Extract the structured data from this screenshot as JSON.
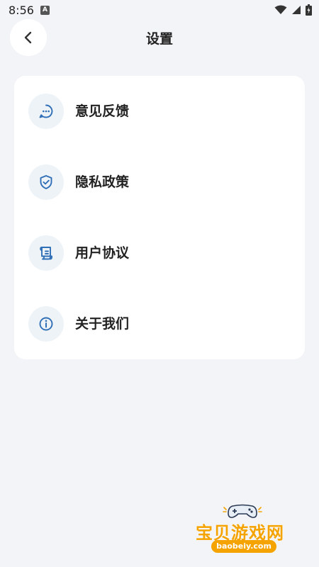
{
  "status_bar": {
    "time": "8:56",
    "notification_letter": "A"
  },
  "header": {
    "title": "设置"
  },
  "settings": {
    "items": [
      {
        "label": "意见反馈",
        "icon": "feedback-chat-icon"
      },
      {
        "label": "隐私政策",
        "icon": "shield-check-icon"
      },
      {
        "label": "用户协议",
        "icon": "scroll-document-icon"
      },
      {
        "label": "关于我们",
        "icon": "info-icon"
      }
    ]
  },
  "watermark": {
    "text": "宝贝游戏网",
    "url": "baobeiy.com"
  },
  "colors": {
    "background": "#f3f4f7",
    "card": "#ffffff",
    "icon_accent": "#2f6fb6",
    "icon_bg": "#eef3f8",
    "watermark": "#f4a300"
  }
}
